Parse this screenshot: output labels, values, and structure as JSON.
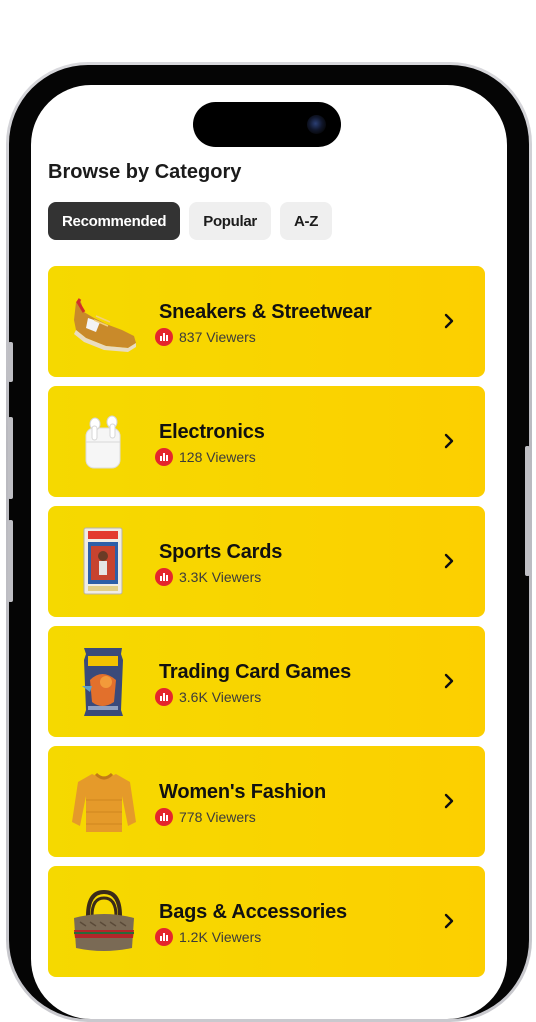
{
  "browse": {
    "title": "Browse by Category",
    "tabs": [
      {
        "label": "Recommended",
        "active": true
      },
      {
        "label": "Popular",
        "active": false
      },
      {
        "label": "A-Z",
        "active": false
      }
    ]
  },
  "categories": [
    {
      "title": "Sneakers & Streetwear",
      "viewers": "837 Viewers",
      "icon": "sneaker-icon"
    },
    {
      "title": "Electronics",
      "viewers": "128 Viewers",
      "icon": "airpods-icon"
    },
    {
      "title": "Sports Cards",
      "viewers": "3.3K Viewers",
      "icon": "graded-card-icon"
    },
    {
      "title": "Trading Card Games",
      "viewers": "3.6K Viewers",
      "icon": "card-pack-icon"
    },
    {
      "title": "Women's Fashion",
      "viewers": "778 Viewers",
      "icon": "sweater-icon"
    },
    {
      "title": "Bags & Accessories",
      "viewers": "1.2K Viewers",
      "icon": "handbag-icon"
    }
  ],
  "colors": {
    "card_start": "#f5d900",
    "card_end": "#fccf00",
    "live_badge": "#e5262c",
    "active_tab": "#333333",
    "inactive_tab": "#efefef"
  }
}
